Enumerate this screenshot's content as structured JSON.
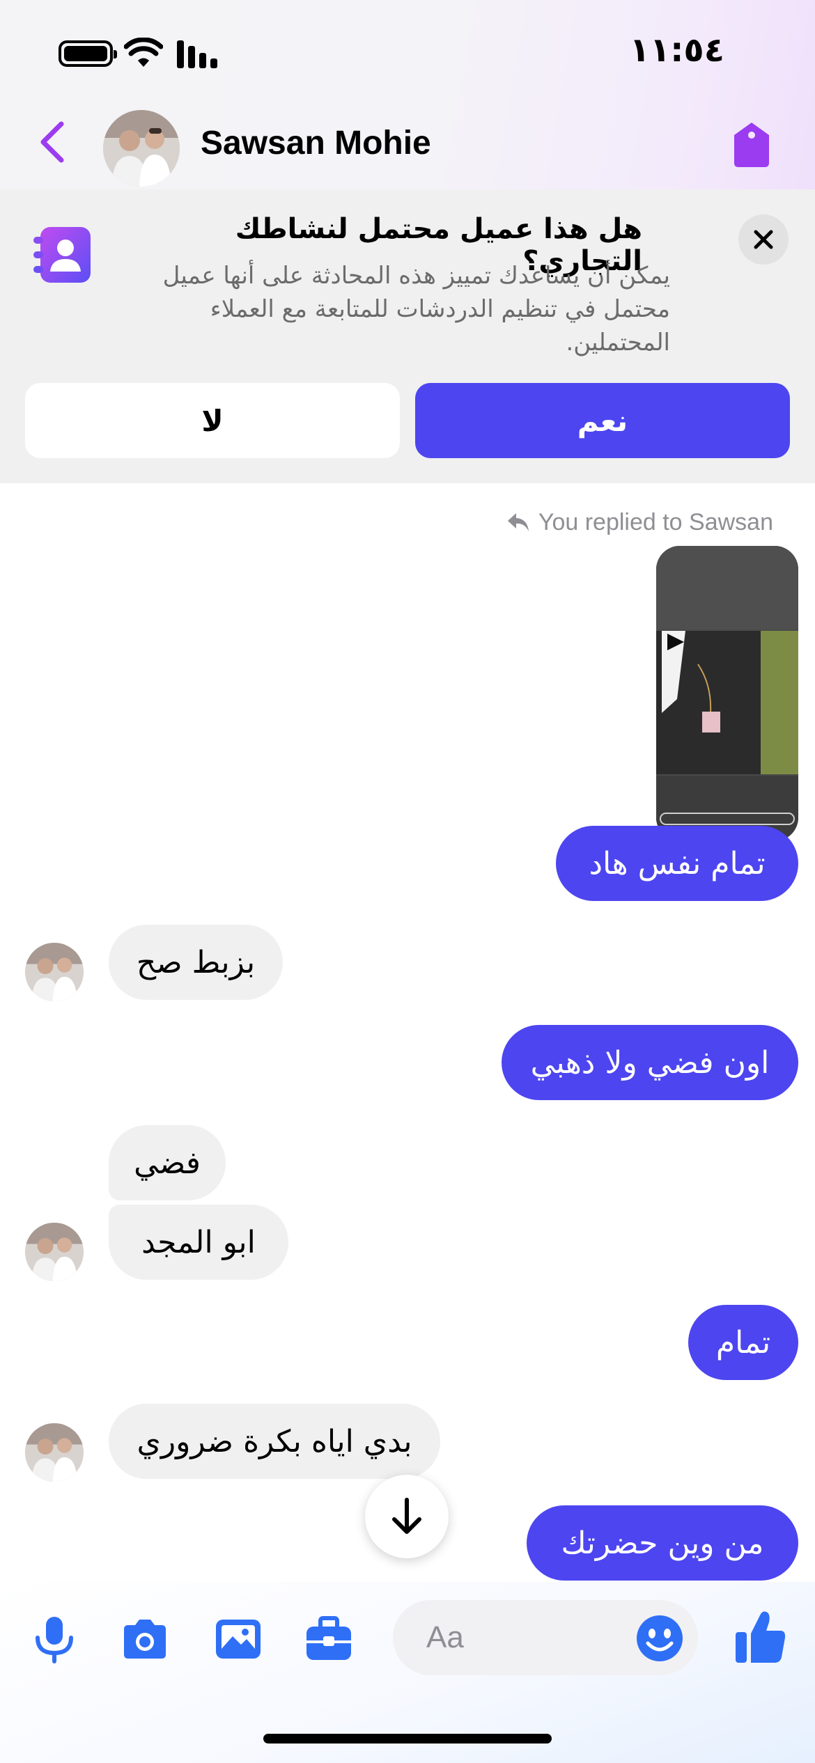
{
  "status_bar": {
    "time": "١١:٥٤"
  },
  "header": {
    "contact_name": "Sawsan Mohie"
  },
  "banner": {
    "title": "هل هذا عميل محتمل لنشاطك التجاري؟",
    "description": "يمكن أن يساعدك تمييز هذه المحادثة على أنها عميل محتمل في تنظيم الدردشات للمتابعة مع العملاء المحتملين.",
    "yes_label": "نعم",
    "no_label": "لا"
  },
  "chat": {
    "replied_label": "You replied to Sawsan",
    "messages": [
      {
        "side": "out",
        "text": "تمام نفس هاد"
      },
      {
        "side": "in",
        "text": "بزبط صح"
      },
      {
        "side": "out",
        "text": "اون فضي ولا ذهبي"
      },
      {
        "side": "in",
        "text": "فضي"
      },
      {
        "side": "in",
        "text": "ابو المجد"
      },
      {
        "side": "out",
        "text": "تمام"
      },
      {
        "side": "in",
        "text": "بدي اياه بكرة ضروري"
      },
      {
        "side": "out",
        "text": "من وين حضرتك"
      }
    ]
  },
  "composer": {
    "placeholder": "Aa"
  },
  "colors": {
    "accent": "#4d45f0",
    "brand_purple": "#9b3cf0",
    "icon_blue": "#2f6ff6"
  }
}
